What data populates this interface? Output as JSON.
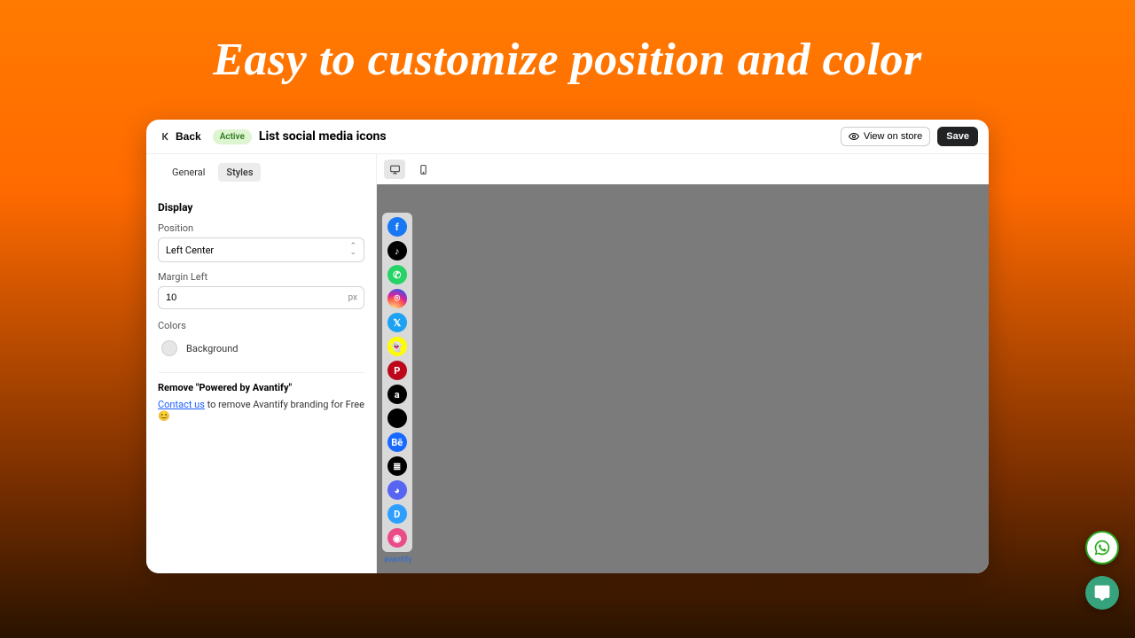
{
  "hero": {
    "title": "Easy to customize position and color"
  },
  "header": {
    "back_label": "Back",
    "status_label": "Active",
    "page_title": "List social media icons",
    "view_on_store_label": "View on store",
    "save_label": "Save"
  },
  "sidebar": {
    "tabs": {
      "general": "General",
      "styles": "Styles",
      "active": "styles"
    },
    "display_title": "Display",
    "position_label": "Position",
    "position_value": "Left Center",
    "margin_left_label": "Margin Left",
    "margin_left_value": "10",
    "margin_left_suffix": "px",
    "colors_label": "Colors",
    "background_label": "Background",
    "background_value": "#e6e6e6",
    "remove_title": "Remove \"Powered by Avantify\"",
    "contact_link_text": "Contact us",
    "remove_tail_text": " to remove Avantify branding for Free 😊"
  },
  "preview": {
    "watermark": "avantify",
    "icons": [
      {
        "name": "facebook",
        "label": "f",
        "css": "ic-facebook"
      },
      {
        "name": "tiktok",
        "label": "♪",
        "css": "ic-tiktok"
      },
      {
        "name": "whatsapp",
        "label": "✆",
        "css": "ic-whatsapp"
      },
      {
        "name": "instagram",
        "label": "⌾",
        "css": "ic-instagram"
      },
      {
        "name": "twitter",
        "label": "𝕏",
        "css": "ic-twitter"
      },
      {
        "name": "snapchat",
        "label": "👻",
        "css": "ic-snapchat"
      },
      {
        "name": "pinterest",
        "label": "P",
        "css": "ic-pinterest"
      },
      {
        "name": "amazon",
        "label": "a",
        "css": "ic-amazon"
      },
      {
        "name": "apple",
        "label": "",
        "css": "ic-apple"
      },
      {
        "name": "behance",
        "label": "Bē",
        "css": "ic-behance"
      },
      {
        "name": "buffer",
        "label": "≣",
        "css": "ic-buffer"
      },
      {
        "name": "discord",
        "label": "◕",
        "css": "ic-discord"
      },
      {
        "name": "disqus",
        "label": "D",
        "css": "ic-disqus"
      },
      {
        "name": "dribbble",
        "label": "◉",
        "css": "ic-dribbble"
      }
    ]
  }
}
